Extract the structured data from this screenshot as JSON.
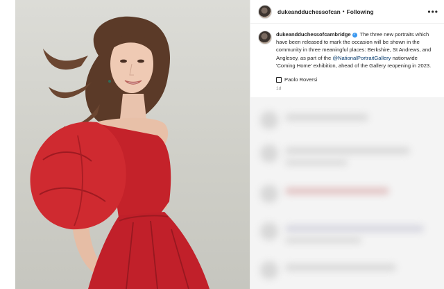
{
  "post": {
    "author": "dukeandduchessofcan",
    "follow_label": "Following",
    "more_glyph": "•••"
  },
  "caption": {
    "username": "dukeandduchessofcambridge",
    "text_before": " The three new portraits which have been released to mark the occasion will be shown in the community in three meaningful places: Berkshire, St Andrews, and Anglesey, as part of the ",
    "mention": "@NationalPortraitGallery",
    "text_after": " nationwide 'Coming Home' exhibition, ahead of the Gallery reopening in 2023.",
    "credit": "Paolo Roversi",
    "timestamp": "1d"
  },
  "colors": {
    "dress": "#c4222a",
    "background": "#d2d2cc",
    "link": "#00376b",
    "verified": "#3897f0"
  },
  "icons": [
    "verified-badge-icon",
    "more-options-icon",
    "camera-icon"
  ]
}
